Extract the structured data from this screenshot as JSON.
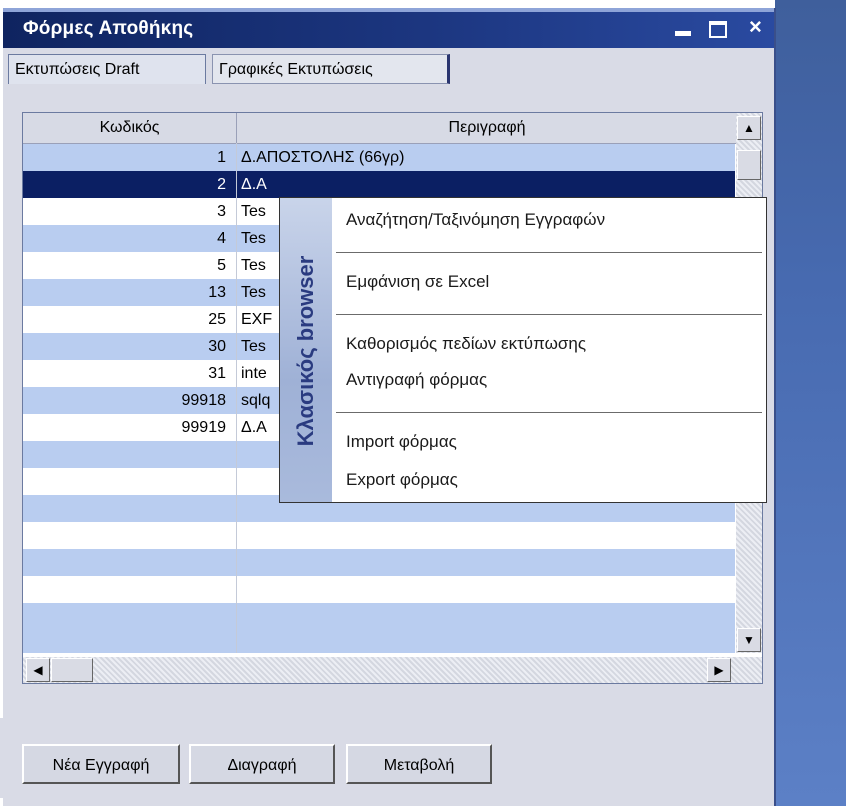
{
  "window": {
    "title": "Φόρμες Αποθήκης",
    "controls": {
      "minimize": "_",
      "maximize": "□",
      "close": "×"
    }
  },
  "tabs": [
    {
      "label": "Εκτυπώσεις Draft",
      "active": true
    },
    {
      "label": "Γραφικές Εκτυπώσεις",
      "active": false
    }
  ],
  "grid": {
    "columns": {
      "code": "Κωδικός",
      "description": "Περιγραφή"
    },
    "rows": [
      {
        "code": "1",
        "description": "Δ.ΑΠΟΣΤΟΛΗΣ (66γρ)"
      },
      {
        "code": "2",
        "description": "Δ.Α"
      },
      {
        "code": "3",
        "description": "Tes"
      },
      {
        "code": "4",
        "description": "Tes"
      },
      {
        "code": "5",
        "description": "Tes"
      },
      {
        "code": "13",
        "description": "Tes"
      },
      {
        "code": "25",
        "description": "EXF"
      },
      {
        "code": "30",
        "description": "Tes"
      },
      {
        "code": "31",
        "description": "inte"
      },
      {
        "code": "99918",
        "description": "sqlq"
      },
      {
        "code": "99919",
        "description": "Δ.Α"
      }
    ],
    "selected_row": 2,
    "scroll_up": "▲",
    "scroll_down": "▼",
    "scroll_left": "◀",
    "scroll_right": "▶"
  },
  "context_menu": {
    "band_label": "Κλασικός browser",
    "items": [
      {
        "label": "Αναζήτηση/Ταξινόμηση Εγγραφών"
      },
      {
        "label": "Εμφάνιση σε Excel"
      },
      {
        "label": "Καθορισμός πεδίων εκτύπωσης"
      },
      {
        "label": "Αντιγραφή φόρμας"
      },
      {
        "label": "Import φόρμας"
      },
      {
        "label": "Export φόρμας"
      }
    ]
  },
  "buttons": {
    "new": "Νέα Εγγραφή",
    "delete": "Διαγραφή",
    "edit": "Μεταβολή"
  },
  "colors": {
    "titlebar": "#0f2460",
    "selected_row": "#0b1f63",
    "alt_row": "#b9cdf0",
    "menu_band": "#9fb1d6"
  }
}
